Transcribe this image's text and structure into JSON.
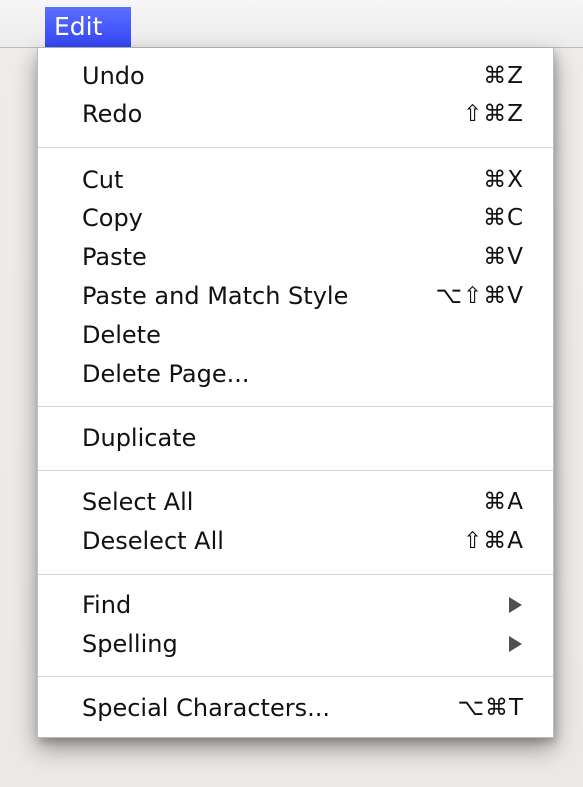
{
  "menubar": {
    "title": "Edit"
  },
  "menu": {
    "items": [
      {
        "label": "Undo",
        "shortcut": "⌘Z"
      },
      {
        "label": "Redo",
        "shortcut": "⇧⌘Z"
      },
      {
        "label": "Cut",
        "shortcut": "⌘X"
      },
      {
        "label": "Copy",
        "shortcut": "⌘C"
      },
      {
        "label": "Paste",
        "shortcut": "⌘V"
      },
      {
        "label": "Paste and Match Style",
        "shortcut": "⌥⇧⌘V"
      },
      {
        "label": "Delete"
      },
      {
        "label": "Delete Page..."
      },
      {
        "label": "Duplicate"
      },
      {
        "label": "Select All",
        "shortcut": "⌘A"
      },
      {
        "label": "Deselect All",
        "shortcut": "⇧⌘A"
      },
      {
        "label": "Find",
        "submenu_icon": "triangle-right-icon"
      },
      {
        "label": "Spelling",
        "submenu_icon": "triangle-right-icon"
      },
      {
        "label": "Special Characters...",
        "shortcut": "⌥⌘T"
      }
    ]
  },
  "colors": {
    "menu_title_highlight": "#3447f5",
    "menu_bg": "#ffffff",
    "separator": "#d7d7d7",
    "text": "#111111"
  }
}
